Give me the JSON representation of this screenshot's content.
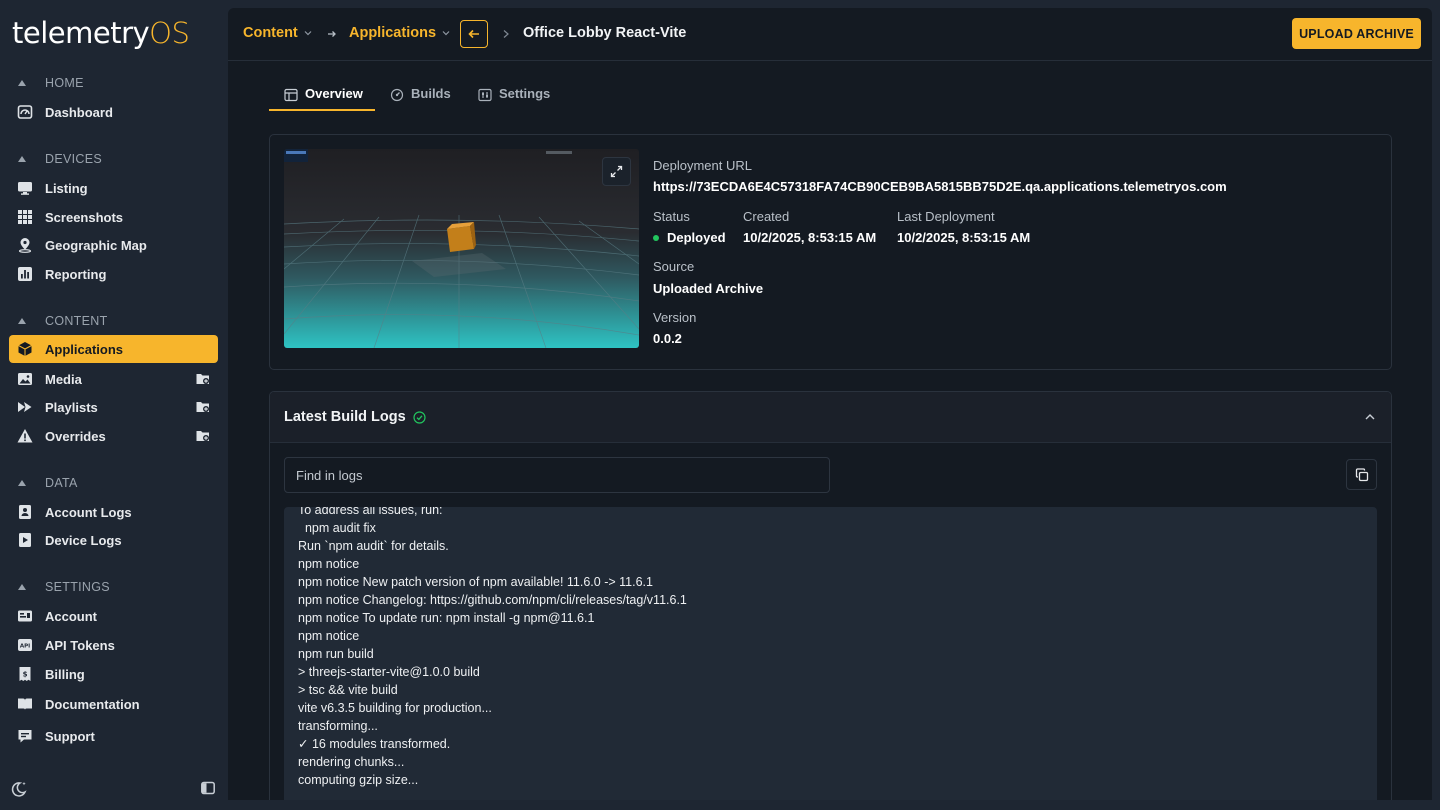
{
  "logo": {
    "main": "telemetry",
    "accent": "OS"
  },
  "sidebar": {
    "sections": [
      {
        "label": "HOME"
      },
      {
        "label": "DEVICES"
      },
      {
        "label": "CONTENT"
      },
      {
        "label": "DATA"
      },
      {
        "label": "SETTINGS"
      }
    ],
    "items": [
      {
        "label": "Dashboard",
        "icon": "dashboard-icon"
      },
      {
        "label": "Listing",
        "icon": "monitor-icon"
      },
      {
        "label": "Screenshots",
        "icon": "grid-icon"
      },
      {
        "label": "Geographic Map",
        "icon": "map-pin-icon"
      },
      {
        "label": "Reporting",
        "icon": "chart-icon"
      },
      {
        "label": "Applications",
        "icon": "cube-icon",
        "active": true
      },
      {
        "label": "Media",
        "icon": "image-icon"
      },
      {
        "label": "Playlists",
        "icon": "playlist-icon"
      },
      {
        "label": "Overrides",
        "icon": "warning-icon"
      },
      {
        "label": "Account Logs",
        "icon": "account-log-icon"
      },
      {
        "label": "Device Logs",
        "icon": "device-log-icon"
      },
      {
        "label": "Account",
        "icon": "account-icon"
      },
      {
        "label": "API Tokens",
        "icon": "api-icon"
      },
      {
        "label": "Billing",
        "icon": "billing-icon"
      },
      {
        "label": "Documentation",
        "icon": "book-icon"
      },
      {
        "label": "Support",
        "icon": "chat-icon"
      }
    ]
  },
  "header": {
    "crumb_content": "Content",
    "crumb_applications": "Applications",
    "title": "Office Lobby React-Vite",
    "upload_label": "UPLOAD ARCHIVE"
  },
  "tabs": [
    {
      "label": "Overview",
      "active": true
    },
    {
      "label": "Builds"
    },
    {
      "label": "Settings"
    }
  ],
  "details": {
    "deployment_url_label": "Deployment URL",
    "deployment_url": "https://73ECDA6E4C57318FA74CB90CEB9BA5815BB75D2E.qa.applications.telemetryos.com",
    "status_label": "Status",
    "status": "Deployed",
    "created_label": "Created",
    "created": "10/2/2025, 8:53:15 AM",
    "last_deployment_label": "Last Deployment",
    "last_deployment": "10/2/2025, 8:53:15 AM",
    "source_label": "Source",
    "source": "Uploaded Archive",
    "version_label": "Version",
    "version": "0.0.2"
  },
  "logs": {
    "title": "Latest Build Logs",
    "search_placeholder": "Find in logs",
    "lines": [
      "To address all issues, run:",
      "  npm audit fix",
      "Run `npm audit` for details.",
      "npm notice",
      "npm notice New patch version of npm available! 11.6.0 -> 11.6.1",
      "npm notice Changelog: https://github.com/npm/cli/releases/tag/v11.6.1",
      "npm notice To update run: npm install -g npm@11.6.1",
      "npm notice",
      "npm run build",
      "> threejs-starter-vite@1.0.0 build",
      "> tsc && vite build",
      "vite v6.3.5 building for production...",
      "transforming...",
      "✓ 16 modules transformed.",
      "rendering chunks...",
      "computing gzip size..."
    ]
  },
  "colors": {
    "accent": "#f7b52c",
    "success": "#22c55e",
    "sidebar_bg": "#1e2632",
    "panel_bg": "#141a22"
  }
}
